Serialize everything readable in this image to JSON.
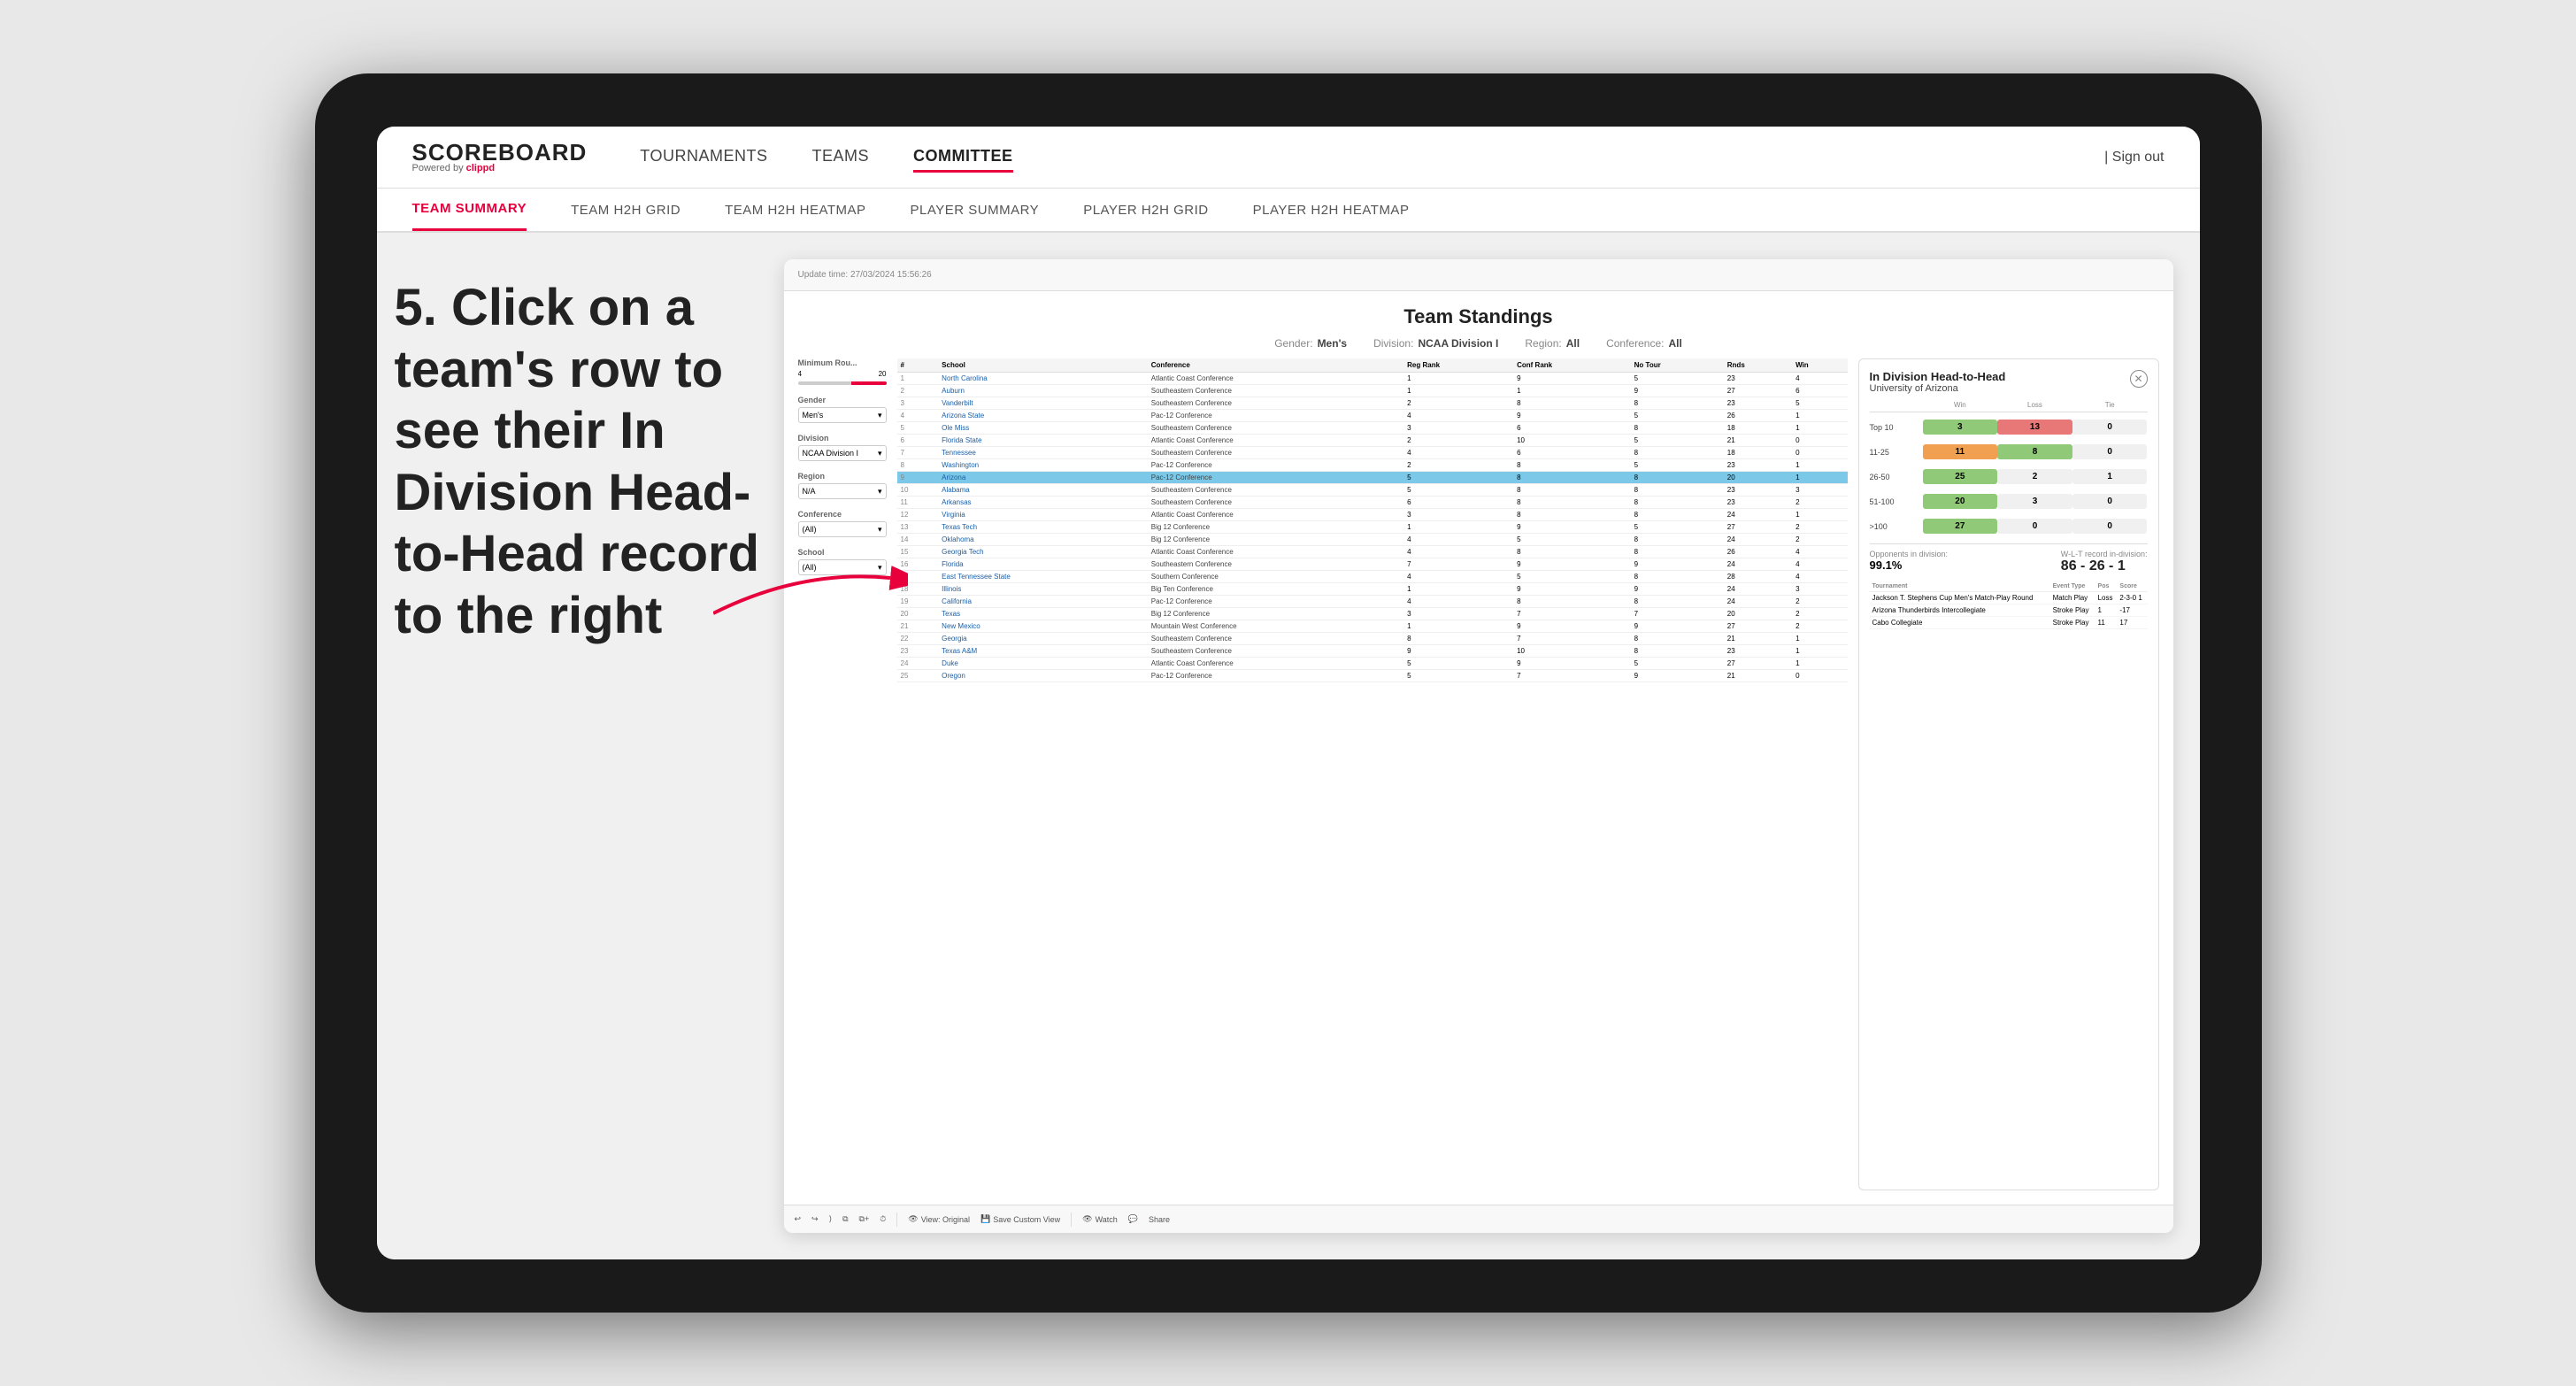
{
  "app": {
    "logo": "SCOREBOARD",
    "logo_sub": "Powered by",
    "logo_brand": "clippd",
    "sign_out": "Sign out"
  },
  "nav": {
    "items": [
      "TOURNAMENTS",
      "TEAMS",
      "COMMITTEE"
    ],
    "active": "COMMITTEE"
  },
  "sub_nav": {
    "items": [
      "TEAM SUMMARY",
      "TEAM H2H GRID",
      "TEAM H2H HEATMAP",
      "PLAYER SUMMARY",
      "PLAYER H2H GRID",
      "PLAYER H2H HEATMAP"
    ],
    "active": "TEAM SUMMARY"
  },
  "annotation": {
    "text": "5. Click on a team's row to see their In Division Head-to-Head record to the right"
  },
  "dashboard": {
    "update_time_label": "Update time:",
    "update_time": "27/03/2024 15:56:26",
    "title": "Team Standings",
    "filters": {
      "gender_label": "Gender:",
      "gender": "Men's",
      "division_label": "Division:",
      "division": "NCAA Division I",
      "region_label": "Region:",
      "region": "All",
      "conference_label": "Conference:",
      "conference": "All"
    },
    "left_filters": {
      "min_rounds_label": "Minimum Rou...",
      "min_rounds_values": [
        "4",
        "20"
      ],
      "gender_label": "Gender",
      "gender_value": "Men's",
      "division_label": "Division",
      "division_value": "NCAA Division I",
      "region_label": "Region",
      "region_value": "N/A",
      "conference_label": "Conference",
      "conference_value": "(All)",
      "school_label": "School",
      "school_value": "(All)"
    },
    "table": {
      "headers": [
        "#",
        "School",
        "Conference",
        "Reg Rank",
        "Conf Rank",
        "No Tour",
        "Rnds",
        "Win"
      ],
      "rows": [
        [
          1,
          "North Carolina",
          "Atlantic Coast Conference",
          1,
          9,
          5,
          23,
          4
        ],
        [
          2,
          "Auburn",
          "Southeastern Conference",
          1,
          1,
          9,
          27,
          6
        ],
        [
          3,
          "Vanderbilt",
          "Southeastern Conference",
          2,
          8,
          8,
          23,
          5
        ],
        [
          4,
          "Arizona State",
          "Pac-12 Conference",
          4,
          9,
          5,
          26,
          1
        ],
        [
          5,
          "Ole Miss",
          "Southeastern Conference",
          3,
          6,
          8,
          18,
          1
        ],
        [
          6,
          "Florida State",
          "Atlantic Coast Conference",
          2,
          10,
          5,
          21,
          0
        ],
        [
          7,
          "Tennessee",
          "Southeastern Conference",
          4,
          6,
          8,
          18,
          0
        ],
        [
          8,
          "Washington",
          "Pac-12 Conference",
          2,
          8,
          5,
          23,
          1
        ],
        [
          9,
          "Arizona",
          "Pac-12 Conference",
          5,
          8,
          8,
          20,
          1
        ],
        [
          10,
          "Alabama",
          "Southeastern Conference",
          5,
          8,
          8,
          23,
          3
        ],
        [
          11,
          "Arkansas",
          "Southeastern Conference",
          6,
          8,
          8,
          23,
          2
        ],
        [
          12,
          "Virginia",
          "Atlantic Coast Conference",
          3,
          8,
          8,
          24,
          1
        ],
        [
          13,
          "Texas Tech",
          "Big 12 Conference",
          1,
          9,
          5,
          27,
          2
        ],
        [
          14,
          "Oklahoma",
          "Big 12 Conference",
          4,
          5,
          8,
          24,
          2
        ],
        [
          15,
          "Georgia Tech",
          "Atlantic Coast Conference",
          4,
          8,
          8,
          26,
          4
        ],
        [
          16,
          "Florida",
          "Southeastern Conference",
          7,
          9,
          9,
          24,
          4
        ],
        [
          17,
          "East Tennessee State",
          "Southern Conference",
          4,
          5,
          8,
          28,
          4
        ],
        [
          18,
          "Illinois",
          "Big Ten Conference",
          1,
          9,
          9,
          24,
          3
        ],
        [
          19,
          "California",
          "Pac-12 Conference",
          4,
          8,
          8,
          24,
          2
        ],
        [
          20,
          "Texas",
          "Big 12 Conference",
          3,
          7,
          7,
          20,
          2
        ],
        [
          21,
          "New Mexico",
          "Mountain West Conference",
          1,
          9,
          9,
          27,
          2
        ],
        [
          22,
          "Georgia",
          "Southeastern Conference",
          8,
          7,
          8,
          21,
          1
        ],
        [
          23,
          "Texas A&M",
          "Southeastern Conference",
          9,
          10,
          8,
          23,
          1
        ],
        [
          24,
          "Duke",
          "Atlantic Coast Conference",
          5,
          9,
          5,
          27,
          1
        ],
        [
          25,
          "Oregon",
          "Pac-12 Conference",
          5,
          7,
          9,
          21,
          0
        ]
      ]
    },
    "h2h": {
      "title": "In Division Head-to-Head",
      "team": "University of Arizona",
      "headers": [
        "",
        "Win",
        "Loss",
        "Tie"
      ],
      "rows": [
        {
          "label": "Top 10",
          "win": 3,
          "loss": 13,
          "tie": 0,
          "win_color": "green",
          "loss_color": "red"
        },
        {
          "label": "11-25",
          "win": 11,
          "loss": 8,
          "tie": 0,
          "win_color": "orange",
          "loss_color": "green"
        },
        {
          "label": "26-50",
          "win": 25,
          "loss": 2,
          "tie": 1,
          "win_color": "green",
          "loss_color": "gray"
        },
        {
          "label": "51-100",
          "win": 20,
          "loss": 3,
          "tie": 0,
          "win_color": "green",
          "loss_color": "gray"
        },
        {
          "label": ">100",
          "win": 27,
          "loss": 0,
          "tie": 0,
          "win_color": "green",
          "loss_color": "gray"
        }
      ],
      "opponents_label": "Opponents in division:",
      "opponents_value": "99.1%",
      "record_label": "W-L-T record in-division:",
      "record_value": "86 - 26 - 1",
      "tournaments": [
        {
          "name": "Jackson T. Stephens Cup Men's Match-Play Round",
          "type": "Match Play",
          "pos": "Loss",
          "score": "2-3-0 1"
        },
        {
          "name": "Arizona Thunderbirds Intercollegiate",
          "type": "Stroke Play",
          "pos": "1",
          "score": "-17"
        },
        {
          "name": "Cabo Collegiate",
          "type": "Stroke Play",
          "pos": "11",
          "score": "17"
        }
      ],
      "tournament_headers": [
        "Tournament",
        "Event Type",
        "Pos",
        "Score"
      ]
    },
    "bottom_toolbar": {
      "view_original": "View: Original",
      "save_custom": "Save Custom View",
      "watch": "Watch",
      "share": "Share"
    }
  }
}
